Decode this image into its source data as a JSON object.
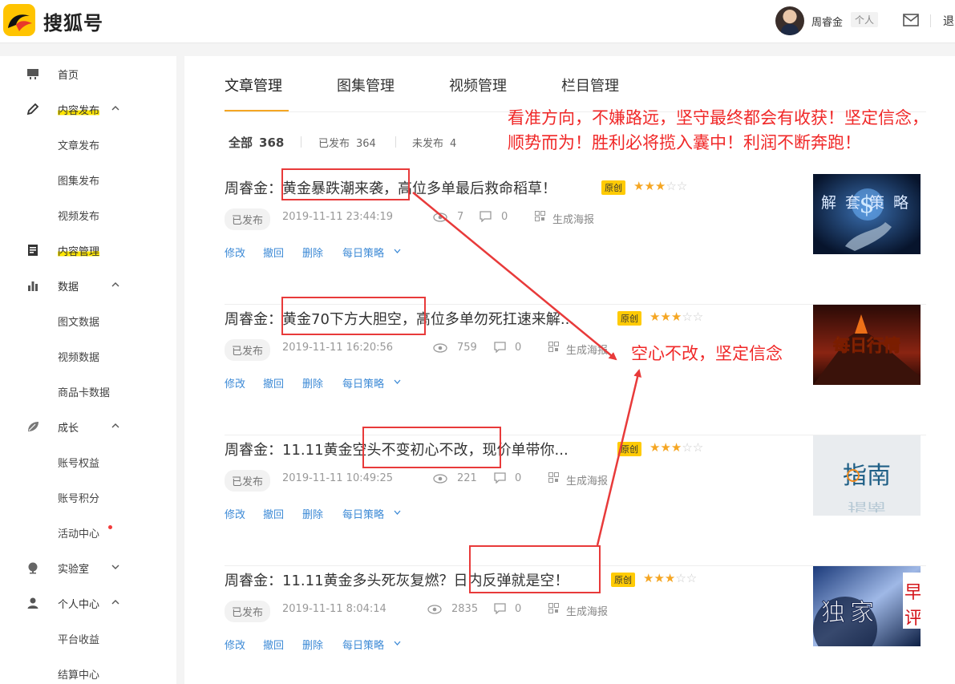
{
  "header": {
    "brand": "搜狐号",
    "user_name": "周睿金",
    "user_tag": "个人",
    "logout": "退"
  },
  "sidebar": {
    "items": [
      {
        "label": "首页",
        "icon": "monitor-icon"
      },
      {
        "label": "内容发布",
        "icon": "pen-icon",
        "highlighted": true
      },
      {
        "label": "文章发布"
      },
      {
        "label": "图集发布"
      },
      {
        "label": "视频发布"
      },
      {
        "label": "内容管理",
        "icon": "document-icon",
        "highlighted": true
      },
      {
        "label": "数据",
        "icon": "bar-chart-icon"
      },
      {
        "label": "图文数据"
      },
      {
        "label": "视频数据"
      },
      {
        "label": "商品卡数据"
      },
      {
        "label": "成长",
        "icon": "leaf-icon"
      },
      {
        "label": "账号权益"
      },
      {
        "label": "账号积分"
      },
      {
        "label": "活动中心"
      },
      {
        "label": "实验室",
        "icon": "globe-icon"
      },
      {
        "label": "个人中心",
        "icon": "user-icon"
      },
      {
        "label": "平台收益"
      },
      {
        "label": "结算中心"
      }
    ]
  },
  "tabs": [
    "文章管理",
    "图集管理",
    "视频管理",
    "栏目管理"
  ],
  "filters": {
    "all_label": "全部",
    "all_count": "368",
    "published_label": "已发布",
    "published_count": "364",
    "unpublished_label": "未发布",
    "unpublished_count": "4"
  },
  "articles": [
    {
      "title_prefix": "周睿金：",
      "title_highlight": "黄金暴跌潮来袭",
      "title_rest": "，高位多单最后救命稻草！",
      "badge": "原创",
      "stars": 3,
      "status": "已发布",
      "time": "2019-11-11 23:44:19",
      "views": "7",
      "comments": "0",
      "poster": "生成海报",
      "thumb_text": "解套策略"
    },
    {
      "title_prefix": "周睿金：",
      "title_highlight": "黄金70下方大胆空",
      "title_rest": "，高位多单勿死扛速来解...",
      "badge": "原创",
      "stars": 3,
      "status": "已发布",
      "time": "2019-11-11 16:20:56",
      "views": "759",
      "comments": "0",
      "poster": "生成海报",
      "thumb_text": "每日行情"
    },
    {
      "title_prefix": "周睿金：11.11黄金",
      "title_highlight": "空头不变初心不改",
      "title_rest": "，现价单带你...",
      "badge": "原创",
      "stars": 3,
      "status": "已发布",
      "time": "2019-11-11 10:49:25",
      "views": "221",
      "comments": "0",
      "poster": "生成海报",
      "thumb_text": "指南"
    },
    {
      "title_prefix": "周睿金：11.11黄金多头死灰复燃？",
      "title_highlight": "日内反弹就是空！",
      "title_rest": "",
      "badge": "原创",
      "stars": 3,
      "status": "已发布",
      "time": "2019-11-11 8:04:14",
      "views": "2835",
      "comments": "0",
      "poster": "生成海报",
      "thumb_text": "独家"
    }
  ],
  "actions": {
    "edit": "修改",
    "withdraw": "撤回",
    "delete": "删除",
    "strategy": "每日策略"
  },
  "annotations": {
    "slogan": "看准方向，不嫌路远，坚守最终都会有收获！坚定信念，顺势而为！胜利必将揽入囊中！利润不断奔跑！",
    "callout": "空心不改，坚定信念",
    "color": "#f02828"
  },
  "colors": {
    "brand": "#ffc400",
    "accent": "#f5a623",
    "link": "#3d8ad6",
    "badge": "#ffcb05"
  }
}
